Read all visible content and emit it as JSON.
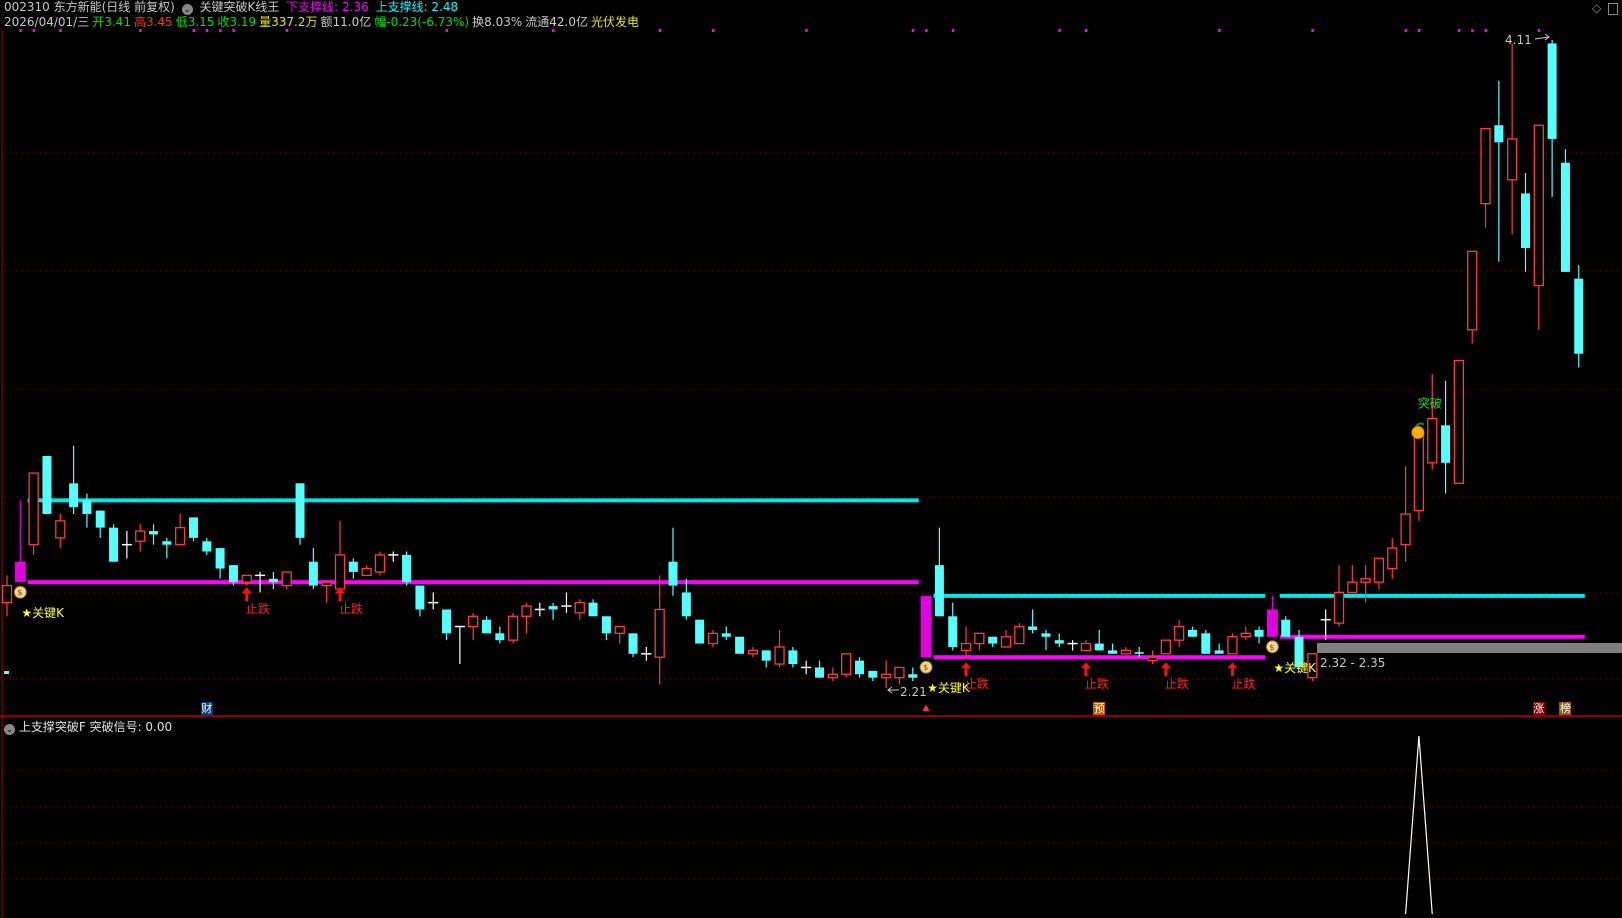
{
  "header": {
    "code_name": "002310 东方新能(日线 前复权)",
    "indicator_name": "关键突破K线王",
    "lower_support": "下支撑线: 2.36",
    "upper_support": "上支撑线: 2.48",
    "date": "2026/04/01/三",
    "open_label": "开",
    "open": "3.41",
    "high_label": "高",
    "high": "3.45",
    "low": "低3.15",
    "close": "收3.19",
    "volume": "量337.2万",
    "amount": "额11.0亿",
    "change": "幅-0.23(-6.73%)",
    "turnover": "换8.03%",
    "float_cap": "流通42.0亿",
    "sector": "光伏发电"
  },
  "lower_panel": {
    "name": "上支撑突破F",
    "signal_text": "突破信号: 0.00"
  },
  "icons": {
    "settings": "circle-chevron-icon",
    "top_right_1": "diamond-icon",
    "top_right_2": "window-icon"
  },
  "colors": {
    "up": "#ff3b3b",
    "down": "#54ffff",
    "key": "#e000e0",
    "upper_line": "#00e8e8",
    "lower_line": "#ff00ff",
    "grid": "#8b0000",
    "doji": "#ffffff"
  },
  "bottom_markers": [
    {
      "label": "财",
      "index": 15,
      "bg": "#0a3c78"
    },
    {
      "label": "▲",
      "index": 69,
      "bg": "#000000"
    },
    {
      "label": "预",
      "index": 82,
      "bg": "#c05a00"
    },
    {
      "label": "涨",
      "index": 115,
      "bg": "#8a0000"
    },
    {
      "label": "榜",
      "index": 117,
      "bg": "#9a5a00"
    }
  ],
  "chart_data": {
    "type": "candlestick",
    "ylim": [
      2.21,
      4.11
    ],
    "ohlc": [
      [
        2.46,
        2.51,
        2.54,
        2.42
      ],
      [
        2.52,
        2.58,
        2.76,
        2.52
      ],
      [
        2.63,
        2.84,
        2.84,
        2.6
      ],
      [
        2.89,
        2.72,
        2.89,
        2.72
      ],
      [
        2.65,
        2.7,
        2.72,
        2.62
      ],
      [
        2.81,
        2.74,
        2.92,
        2.72
      ],
      [
        2.76,
        2.72,
        2.78,
        2.68
      ],
      [
        2.73,
        2.68,
        2.73,
        2.65
      ],
      [
        2.68,
        2.58,
        2.69,
        2.58
      ],
      [
        2.63,
        2.63,
        2.67,
        2.59
      ],
      [
        2.64,
        2.67,
        2.69,
        2.61
      ],
      [
        2.67,
        2.66,
        2.69,
        2.63
      ],
      [
        2.64,
        2.63,
        2.65,
        2.59
      ],
      [
        2.63,
        2.68,
        2.72,
        2.63
      ],
      [
        2.71,
        2.65,
        2.71,
        2.64
      ],
      [
        2.64,
        2.61,
        2.65,
        2.6
      ],
      [
        2.62,
        2.56,
        2.62,
        2.53
      ],
      [
        2.57,
        2.52,
        2.57,
        2.51
      ],
      [
        2.52,
        2.54,
        2.54,
        2.51
      ],
      [
        2.54,
        2.54,
        2.55,
        2.49
      ],
      [
        2.53,
        2.52,
        2.55,
        2.5
      ],
      [
        2.51,
        2.55,
        2.55,
        2.5
      ],
      [
        2.81,
        2.65,
        2.81,
        2.63
      ],
      [
        2.58,
        2.51,
        2.62,
        2.5
      ],
      [
        2.51,
        2.52,
        2.52,
        2.46
      ],
      [
        2.5,
        2.6,
        2.7,
        2.5
      ],
      [
        2.58,
        2.55,
        2.59,
        2.53
      ],
      [
        2.54,
        2.56,
        2.57,
        2.54
      ],
      [
        2.55,
        2.6,
        2.61,
        2.54
      ],
      [
        2.6,
        2.6,
        2.61,
        2.58
      ],
      [
        2.6,
        2.52,
        2.61,
        2.51
      ],
      [
        2.51,
        2.44,
        2.51,
        2.42
      ],
      [
        2.46,
        2.46,
        2.49,
        2.44
      ],
      [
        2.44,
        2.37,
        2.44,
        2.35
      ],
      [
        2.39,
        2.39,
        2.39,
        2.28
      ],
      [
        2.39,
        2.42,
        2.43,
        2.35
      ],
      [
        2.41,
        2.37,
        2.42,
        2.37
      ],
      [
        2.37,
        2.35,
        2.39,
        2.34
      ],
      [
        2.35,
        2.42,
        2.43,
        2.34
      ],
      [
        2.42,
        2.45,
        2.46,
        2.37
      ],
      [
        2.44,
        2.44,
        2.46,
        2.42
      ],
      [
        2.45,
        2.44,
        2.46,
        2.41
      ],
      [
        2.45,
        2.45,
        2.49,
        2.43
      ],
      [
        2.43,
        2.46,
        2.47,
        2.41
      ],
      [
        2.46,
        2.42,
        2.47,
        2.42
      ],
      [
        2.42,
        2.37,
        2.42,
        2.35
      ],
      [
        2.37,
        2.39,
        2.39,
        2.34
      ],
      [
        2.37,
        2.31,
        2.37,
        2.3
      ],
      [
        2.31,
        2.31,
        2.33,
        2.29
      ],
      [
        2.3,
        2.44,
        2.54,
        2.22
      ],
      [
        2.58,
        2.51,
        2.68,
        2.48
      ],
      [
        2.49,
        2.42,
        2.53,
        2.41
      ],
      [
        2.41,
        2.34,
        2.41,
        2.34
      ],
      [
        2.34,
        2.37,
        2.38,
        2.33
      ],
      [
        2.37,
        2.36,
        2.39,
        2.35
      ],
      [
        2.36,
        2.31,
        2.36,
        2.31
      ],
      [
        2.31,
        2.32,
        2.33,
        2.3
      ],
      [
        2.32,
        2.29,
        2.32,
        2.27
      ],
      [
        2.28,
        2.33,
        2.38,
        2.27
      ],
      [
        2.32,
        2.28,
        2.33,
        2.27
      ],
      [
        2.27,
        2.27,
        2.29,
        2.25
      ],
      [
        2.27,
        2.24,
        2.29,
        2.24
      ],
      [
        2.24,
        2.25,
        2.27,
        2.23
      ],
      [
        2.25,
        2.31,
        2.31,
        2.24
      ],
      [
        2.29,
        2.25,
        2.3,
        2.24
      ],
      [
        2.26,
        2.24,
        2.26,
        2.23
      ],
      [
        2.24,
        2.25,
        2.29,
        2.21
      ],
      [
        2.24,
        2.27,
        2.27,
        2.22
      ],
      [
        2.25,
        2.24,
        2.27,
        2.23
      ],
      [
        2.3,
        2.48,
        2.48,
        2.3
      ],
      [
        2.57,
        2.42,
        2.68,
        2.42
      ],
      [
        2.42,
        2.33,
        2.46,
        2.32
      ],
      [
        2.32,
        2.34,
        2.39,
        2.3
      ],
      [
        2.34,
        2.37,
        2.37,
        2.32
      ],
      [
        2.36,
        2.34,
        2.36,
        2.33
      ],
      [
        2.33,
        2.36,
        2.38,
        2.33
      ],
      [
        2.34,
        2.39,
        2.4,
        2.34
      ],
      [
        2.39,
        2.38,
        2.44,
        2.37
      ],
      [
        2.37,
        2.36,
        2.38,
        2.32
      ],
      [
        2.35,
        2.34,
        2.37,
        2.33
      ],
      [
        2.34,
        2.34,
        2.35,
        2.32
      ],
      [
        2.32,
        2.34,
        2.35,
        2.32
      ],
      [
        2.34,
        2.32,
        2.38,
        2.32
      ],
      [
        2.32,
        2.31,
        2.34,
        2.31
      ],
      [
        2.31,
        2.32,
        2.33,
        2.31
      ],
      [
        2.315,
        2.31,
        2.33,
        2.3
      ],
      [
        2.29,
        2.3,
        2.32,
        2.28
      ],
      [
        2.31,
        2.35,
        2.35,
        2.31
      ],
      [
        2.35,
        2.39,
        2.41,
        2.33
      ],
      [
        2.38,
        2.36,
        2.39,
        2.36
      ],
      [
        2.37,
        2.31,
        2.38,
        2.31
      ],
      [
        2.32,
        2.31,
        2.34,
        2.31
      ],
      [
        2.31,
        2.36,
        2.37,
        2.31
      ],
      [
        2.36,
        2.37,
        2.39,
        2.35
      ],
      [
        2.38,
        2.36,
        2.39,
        2.34
      ],
      [
        2.36,
        2.44,
        2.48,
        2.36
      ],
      [
        2.41,
        2.36,
        2.42,
        2.36
      ],
      [
        2.36,
        2.27,
        2.38,
        2.27
      ],
      [
        2.24,
        2.31,
        2.31,
        2.23
      ],
      [
        2.41,
        2.41,
        2.44,
        2.35
      ],
      [
        2.4,
        2.49,
        2.57,
        2.39
      ],
      [
        2.49,
        2.52,
        2.57,
        2.49
      ],
      [
        2.52,
        2.53,
        2.57,
        2.46
      ],
      [
        2.52,
        2.59,
        2.59,
        2.5
      ],
      [
        2.56,
        2.62,
        2.65,
        2.53
      ],
      [
        2.63,
        2.72,
        2.86,
        2.58
      ],
      [
        2.73,
        2.95,
        2.95,
        2.7
      ],
      [
        2.87,
        3.0,
        3.13,
        2.85
      ],
      [
        2.98,
        2.87,
        3.11,
        2.78
      ],
      [
        2.81,
        3.17,
        3.17,
        2.81
      ],
      [
        3.26,
        3.49,
        3.49,
        3.22
      ],
      [
        3.63,
        3.85,
        3.85,
        3.56
      ],
      [
        3.86,
        3.81,
        3.99,
        3.46
      ],
      [
        3.7,
        3.82,
        4.1,
        3.54
      ],
      [
        3.66,
        3.5,
        3.72,
        3.43
      ],
      [
        3.39,
        3.86,
        3.86,
        3.26
      ],
      [
        4.1,
        3.82,
        4.11,
        3.65
      ],
      [
        3.75,
        3.43,
        3.79,
        3.43
      ],
      [
        3.41,
        3.19,
        3.45,
        3.15
      ]
    ],
    "key_candles": [
      1,
      69,
      95
    ],
    "key_label": "★关键K",
    "support_segments": [
      {
        "upper": 2.76,
        "lower": 2.52,
        "start": 2,
        "end": 68
      },
      {
        "upper": 2.48,
        "lower": 2.3,
        "start": 70,
        "end": 94
      },
      {
        "upper": 2.48,
        "lower": 2.36,
        "start": 96,
        "end": 118
      }
    ],
    "stop_fall_label": "止跌",
    "stop_fall_indices": [
      18,
      25,
      72,
      81,
      87,
      92
    ],
    "breakout_label": "突破",
    "breakout_index": 106,
    "top_signal_indices": [
      1,
      2,
      4,
      10,
      14,
      15,
      16,
      17,
      21,
      33,
      41,
      49,
      53,
      60,
      68,
      69,
      71,
      79,
      81,
      91,
      98,
      105,
      106,
      109,
      110,
      111,
      115
    ],
    "max_label": "4.11",
    "min_label": "2.21",
    "range_label": "2.32 - 2.35",
    "lower_signal": {
      "index": 106,
      "value": 1,
      "ylim": [
        0,
        1
      ]
    }
  }
}
